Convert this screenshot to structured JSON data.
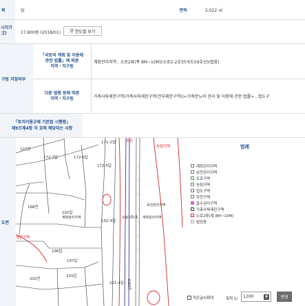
{
  "row1": {
    "label": "목",
    "value": "답",
    "area_label": "면적",
    "area_value": "2,022 ㎡"
  },
  "row2": {
    "label_line1": "시지가",
    "label_line2": "ゴ)",
    "value": "17,800원 (2018/01)",
    "year_button": "연도별 보기"
  },
  "zoning": {
    "side_label": "구등 지정여부",
    "sub1_lines": [
      "「국토의 계획 및 이용에",
      "관한 법률」에 따른",
      "지역・지구등"
    ],
    "sub1_value": "계획관리지역 , 소로2류(폭 8M~10M)(소로2-2호선(국도59호선)(접함)",
    "sub2_lines": [
      "다른 법령 등에 따른",
      "지역・지구등"
    ],
    "sub2_value": "가축사육제한구역(가축사육제한구역(전부제한구역))<가축분뇨의 관리 및 이용에 관한 법률> , 접도구"
  },
  "row4": {
    "lines": [
      "「토지이용규제 기본법 시행령」",
      "제9조제4항 각 호에 해당되는 사항"
    ]
  },
  "map_section": {
    "side_label": "도면",
    "labels": {
      "l1": "107전",
      "l2": "172-7답",
      "l3": "172-6답",
      "l4": "171-2임",
      "l5": "172-5답",
      "l6": "188전",
      "l7": "191답",
      "l8": "계획관리지역",
      "l9": "192-4답",
      "l10": "소로2류(폭",
      "l11": "소로2류(폭",
      "l12": "제한구역",
      "l13": "196답",
      "l14": "197답",
      "l15": "202전",
      "l16": "225답",
      "l17": "221-4답",
      "l18": "소로2류",
      "l19": "농림지역",
      "l20": "보전관리지역",
      "l21": "계획관리지역",
      "l22": "조선"
    }
  },
  "legend": {
    "title": "범례",
    "items": [
      {
        "label": "계획관리지역",
        "color": "#ffffff"
      },
      {
        "label": "보전관리지역",
        "color": "#ffffff"
      },
      {
        "label": "도로구역",
        "color": "#ffffff"
      },
      {
        "label": "농림지역",
        "color": "#ffffff"
      },
      {
        "label": "접도구역",
        "color": "#ffffff"
      },
      {
        "label": "하천구역",
        "color": "#ffffff"
      },
      {
        "label": "홍수관리구역",
        "color": "#e066cc"
      },
      {
        "label": "가축사육제한구역",
        "color": "#ffffff"
      },
      {
        "label": "소로2류(폭 8M~10M)",
        "color": "#ffffff"
      },
      {
        "label": "법정동",
        "color": "#ffffff"
      }
    ],
    "small_map_label": "작은글씨확대",
    "scale_label": "축척 1/",
    "scale_value": "1200",
    "change_button": "변경"
  }
}
